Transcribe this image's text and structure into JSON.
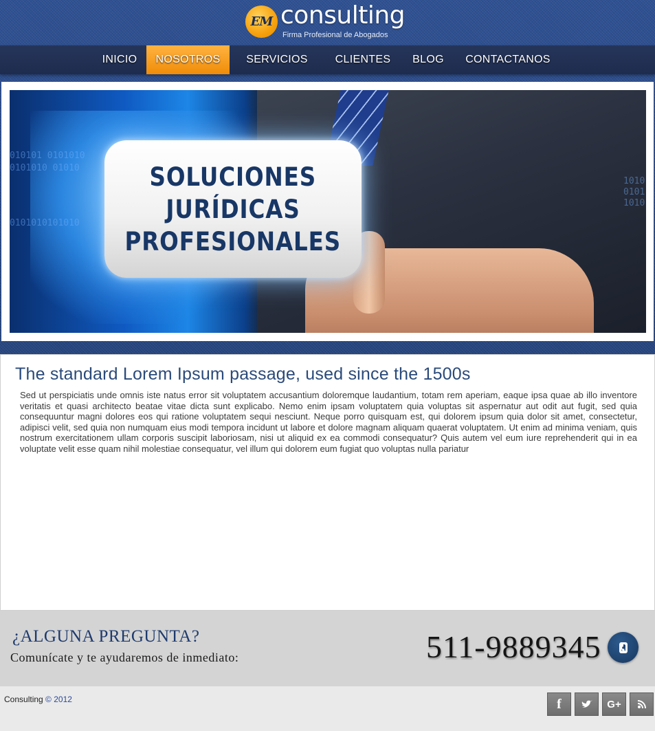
{
  "brand": {
    "logo_mark": "EM",
    "name": "consulting",
    "tagline": "Firma Profesional de Abogados"
  },
  "nav": {
    "items": [
      {
        "label": "INICIO",
        "active": false
      },
      {
        "label": "NOSOTROS",
        "active": true
      },
      {
        "label": "SERVICIOS",
        "active": false
      },
      {
        "label": "CLIENTES",
        "active": false
      },
      {
        "label": "BLOG",
        "active": false
      },
      {
        "label": "CONTACTANOS",
        "active": false
      }
    ]
  },
  "banner": {
    "lines": [
      "SOLUCIONES",
      "JURÍDICAS",
      "PROFESIONALES"
    ],
    "binary_text": [
      "010101 0101010",
      "0101010 01010",
      "0101010101010",
      "1010",
      "0101",
      "1010"
    ]
  },
  "content": {
    "heading": "The standard Lorem Ipsum passage, used since the 1500s",
    "body": "Sed ut perspiciatis unde omnis iste natus error sit voluptatem accusantium doloremque laudantium, totam rem aperiam, eaque ipsa quae ab illo inventore veritatis et quasi architecto beatae vitae dicta sunt explicabo. Nemo enim ipsam voluptatem quia voluptas sit aspernatur aut odit aut fugit, sed quia consequuntur magni dolores eos qui ratione voluptatem sequi nesciunt. Neque porro quisquam est, qui dolorem ipsum quia dolor sit amet, consectetur, adipisci velit, sed quia non numquam eius modi tempora incidunt ut labore et dolore magnam aliquam quaerat voluptatem. Ut enim ad minima veniam, quis nostrum exercitationem ullam corporis suscipit laboriosam, nisi ut aliquid ex ea commodi consequatur? Quis autem vel eum iure reprehenderit qui in ea voluptate velit esse quam nihil molestiae consequatur, vel illum qui dolorem eum fugiat quo voluptas nulla pariatur"
  },
  "contact": {
    "question": "¿ALGUNA PREGUNTA?",
    "subtext": "Comunícate y te ayudaremos de inmediato:",
    "phone": "511-9889345",
    "phone_icon": "phone-icon"
  },
  "footer": {
    "name": "Consulting",
    "copy_symbol": "©",
    "year": "2012",
    "social": [
      {
        "icon": "facebook-icon",
        "glyph": "f"
      },
      {
        "icon": "twitter-icon",
        "glyph": "t"
      },
      {
        "icon": "google-plus-icon",
        "glyph": "G+"
      },
      {
        "icon": "rss-icon",
        "glyph": "rss"
      }
    ]
  },
  "colors": {
    "accent_orange": "#f08c08",
    "brand_blue": "#2a4a7a",
    "nav_bg": "#1e2c4e"
  }
}
